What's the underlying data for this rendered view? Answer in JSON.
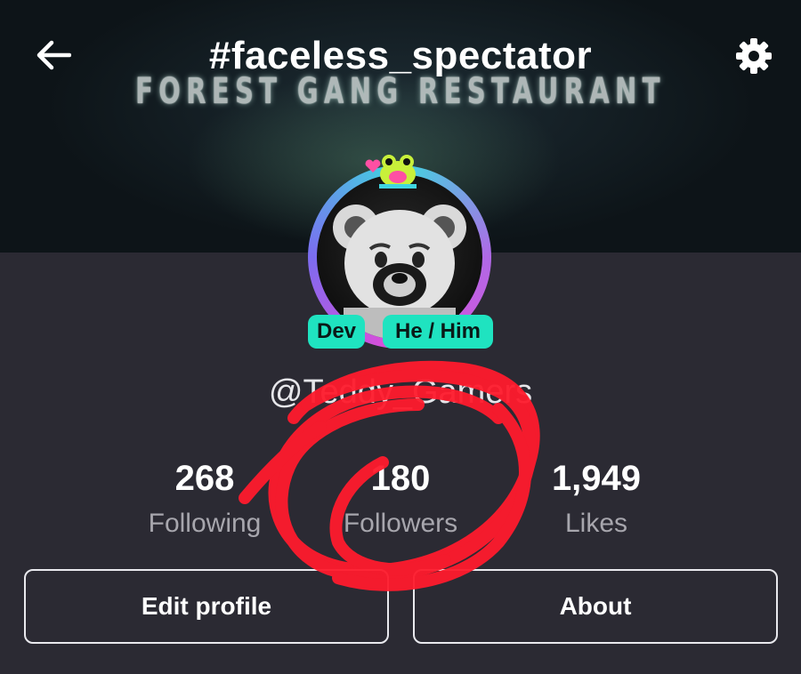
{
  "header": {
    "title": "#faceless_spectator",
    "banner_text": "FOREST GANG RESTAURANT",
    "back_icon": "arrow-left-icon",
    "settings_icon": "gear-icon"
  },
  "profile": {
    "tags": [
      "Dev",
      "He / Him"
    ],
    "username": "@Teddy_Gamers"
  },
  "stats": [
    {
      "value": "268",
      "label": "Following"
    },
    {
      "value": "180",
      "label": "Followers"
    },
    {
      "value": "1,949",
      "label": "Likes"
    }
  ],
  "actions": {
    "edit_label": "Edit profile",
    "about_label": "About"
  },
  "colors": {
    "background": "#2b2a33",
    "tag": "#1fe3c0",
    "scribble": "#ff1b2d"
  }
}
